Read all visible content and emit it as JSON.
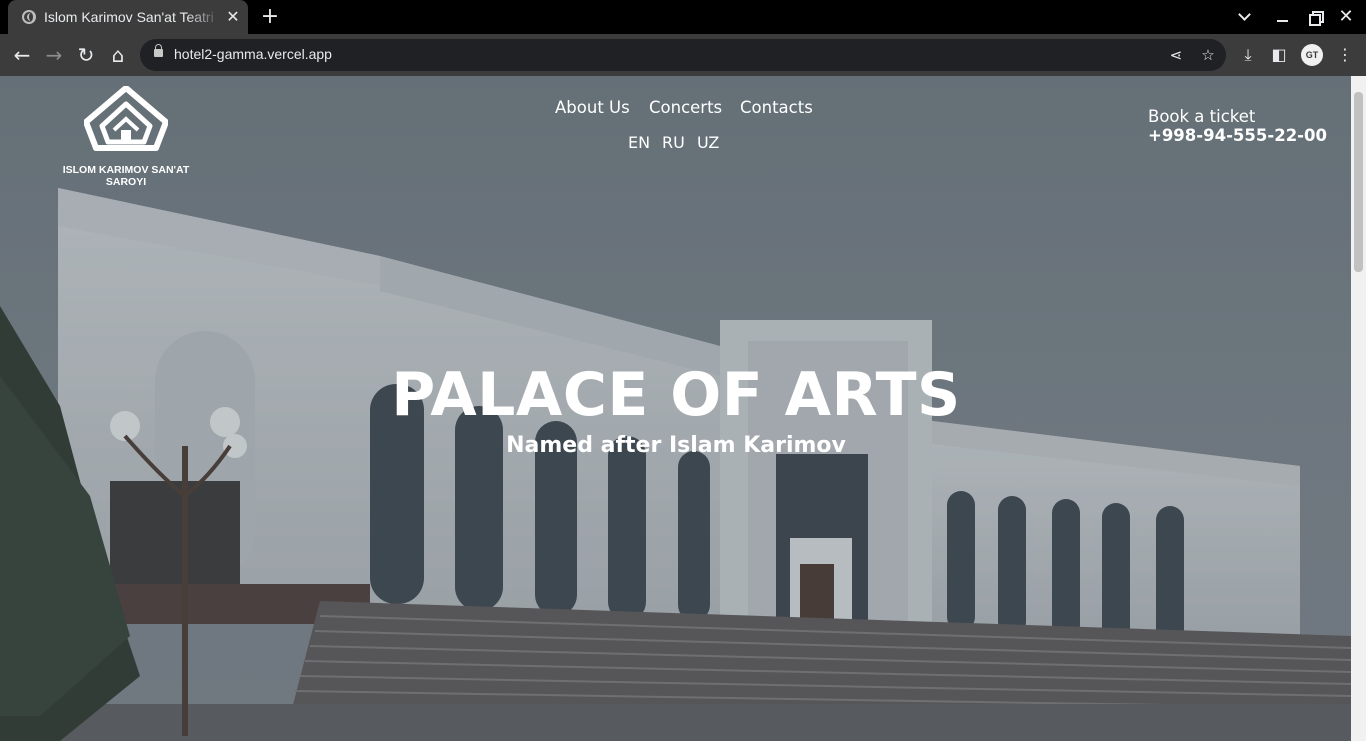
{
  "browser": {
    "tab_title": "Islom Karimov San'at Teatri",
    "url": "hotel2-gamma.vercel.app",
    "profile_initials": "GT"
  },
  "site": {
    "logo_text": "ISLOM KARIMOV SAN'AT SAROYI",
    "nav": [
      "About Us",
      "Concerts",
      "Contacts"
    ],
    "languages": [
      "EN",
      "RU",
      "UZ"
    ],
    "ticket_label": "Book a ticket",
    "ticket_phone": "+998-94-555-22-00",
    "hero_title": "PALACE OF ARTS",
    "hero_subtitle": "Named after Islam Karimov"
  }
}
